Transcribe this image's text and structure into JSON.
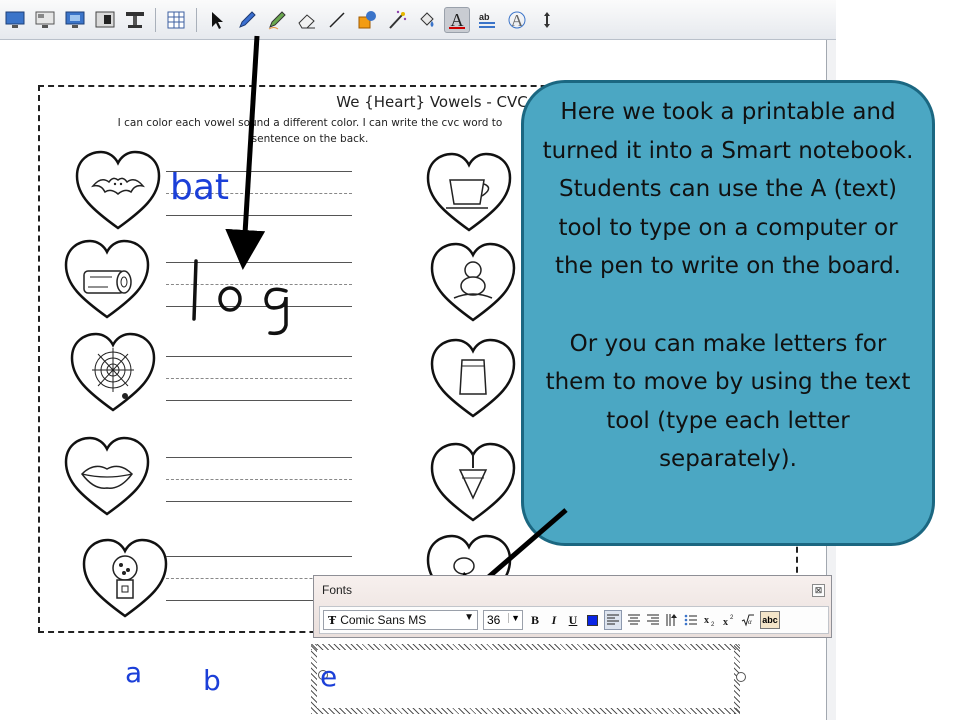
{
  "toolbar": {
    "tools": [
      {
        "icon": "display-icon"
      },
      {
        "icon": "screen-shade-icon"
      },
      {
        "icon": "monitor-icon"
      },
      {
        "icon": "capture-icon"
      },
      {
        "icon": "document-camera-icon"
      },
      {
        "icon": "table-icon"
      },
      {
        "icon": "select-arrow-icon"
      },
      {
        "icon": "pen-icon"
      },
      {
        "icon": "creative-pen-icon"
      },
      {
        "icon": "eraser-icon"
      },
      {
        "icon": "line-icon"
      },
      {
        "icon": "shapes-icon"
      },
      {
        "icon": "magic-pen-icon"
      },
      {
        "icon": "fill-icon"
      },
      {
        "icon": "text-tool-icon"
      },
      {
        "icon": "text-style-icon"
      },
      {
        "icon": "recognition-icon"
      },
      {
        "icon": "move-toolbar-icon"
      }
    ],
    "selected_tool": "text-tool-icon"
  },
  "worksheet": {
    "title": "We {Heart} Vowels - CVC",
    "instructions_line1": "I can color each vowel sound a different color. I can write the cvc word to",
    "instructions_line2": "sentence on the back.",
    "typed_word": "bat",
    "handwritten_word": "log"
  },
  "callout": {
    "paragraph1": "Here we took a printable and turned it into a Smart notebook. Students can use the A (text) tool to type on a computer or the pen to write on the board.",
    "paragraph2": "Or you can make letters for them to move by using the text tool (type each letter separately)."
  },
  "fonts_panel": {
    "title": "Fonts",
    "font_name": "Comic Sans MS",
    "font_size": "36",
    "bold_label": "B",
    "italic_label": "I",
    "underline_label": "U",
    "color": "#0a25e5",
    "spell_label": "abc"
  },
  "letters": [
    "a",
    "b",
    "e"
  ],
  "colors": {
    "callout_fill": "#4ba7c3",
    "callout_border": "#1b6781",
    "handwriting_blue": "#1b3fd8"
  }
}
